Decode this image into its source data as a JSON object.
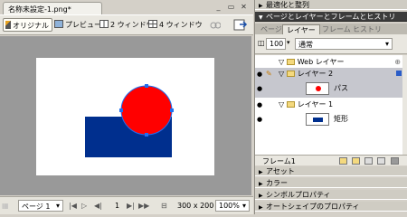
{
  "document": {
    "tab_title": "名称未設定-1.png*",
    "window_buttons": [
      "_",
      "▭",
      "✕"
    ],
    "toolbar": {
      "original": "オリジナル",
      "preview": "プレビュー",
      "two_window": "2 ウィンドウ",
      "four_window": "4 ウィンドウ"
    },
    "status": {
      "page_label": "ページ 1",
      "frame_no": "1",
      "canvas_size": "300 x 200",
      "zoom": "100%"
    },
    "colors": {
      "circle": "#ff0000",
      "rect": "#002f8e",
      "canvas_bg": "#999999"
    }
  },
  "panel": {
    "collapsed_top": "最適化と整列",
    "open_section": "ページとレイヤーとフレームとヒストリ",
    "tabs": [
      "ページ",
      "レイヤー",
      "フレーム",
      "ヒストリ"
    ],
    "opacity": "100",
    "blend_mode": "通常",
    "layers": {
      "web_layer": "Web レイヤー",
      "layer2": "レイヤー 2",
      "path": "パス",
      "layer1": "レイヤー 1",
      "rect": "矩形"
    },
    "frame_label": "フレーム1",
    "sections": [
      "アセット",
      "カラー",
      "シンボルプロパティ",
      "オートシェイプのプロパティ"
    ]
  }
}
